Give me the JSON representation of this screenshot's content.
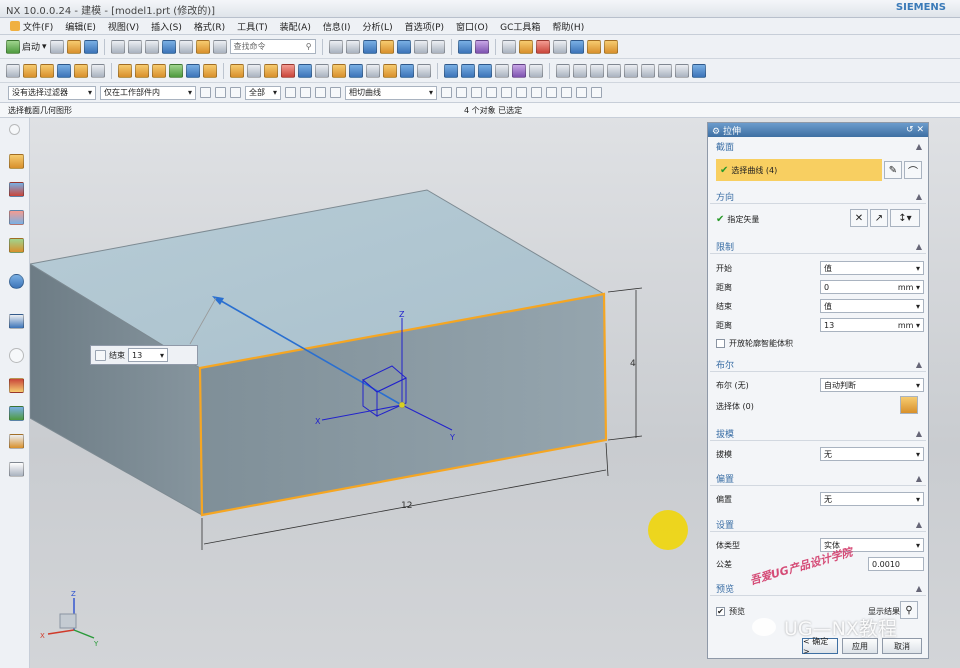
{
  "titlebar": {
    "title": "NX 10.0.0.24 - 建模 - [model1.prt (修改的)]",
    "brand": "SIEMENS"
  },
  "menubar": [
    "文件(F)",
    "编辑(E)",
    "视图(V)",
    "插入(S)",
    "格式(R)",
    "工具(T)",
    "装配(A)",
    "信息(I)",
    "分析(L)",
    "首选项(P)",
    "窗口(O)",
    "GC工具箱",
    "帮助(H)"
  ],
  "toolbar": {
    "start_label": "启动",
    "search_placeholder": "查找命令"
  },
  "selection_bar": {
    "filter": "没有选择过滤器",
    "scope": "仅在工作部件内",
    "type": "全部",
    "curve_rule": "相切曲线"
  },
  "cue_line": {
    "left": "选择截面几何图形",
    "center": "4 个对象 已选定"
  },
  "viewport": {
    "popup_label": "结束",
    "popup_value": "13",
    "dim_width": "12",
    "dim_height": "4",
    "triad_labels": {
      "x": "X",
      "y": "Y",
      "z": "Z"
    }
  },
  "dialog": {
    "title": "拉伸",
    "section": {
      "title": "截面",
      "select_curve": "选择曲线 (4)"
    },
    "direction": {
      "title": "方向",
      "specify_vector": "指定矢量"
    },
    "limits": {
      "title": "限制",
      "start_label": "开始",
      "start_value": "值",
      "distance_label": "距离",
      "start_distance": "0",
      "unit": "mm",
      "end_label": "结束",
      "end_value": "值",
      "end_distance": "13",
      "open_profile": "开放轮廓智能体积"
    },
    "boolean": {
      "title": "布尔",
      "label": "布尔 (无)",
      "value": "自动判断",
      "select_body": "选择体 (0)"
    },
    "draft": {
      "title": "拔模",
      "label": "拔模",
      "value": "无"
    },
    "offset": {
      "title": "偏置",
      "label": "偏置",
      "value": "无"
    },
    "settings": {
      "title": "设置",
      "body_type_label": "体类型",
      "body_type_value": "实体",
      "tolerance_label": "公差",
      "tolerance_value": "0.0010"
    },
    "preview": {
      "title": "预览",
      "preview_label": "预览",
      "show_result": "显示结果"
    },
    "buttons": {
      "ok": "< 确定 >",
      "apply": "应用",
      "cancel": "取消"
    }
  },
  "watermark": {
    "text": "UG—NX教程",
    "stamp": "吾爱UG产品设计学院"
  },
  "colors": {
    "accent": "#3e6fa2",
    "selection_highlight": "#f8cf61",
    "edge_orange": "#f5a623",
    "cursor": "#f0d60e"
  }
}
